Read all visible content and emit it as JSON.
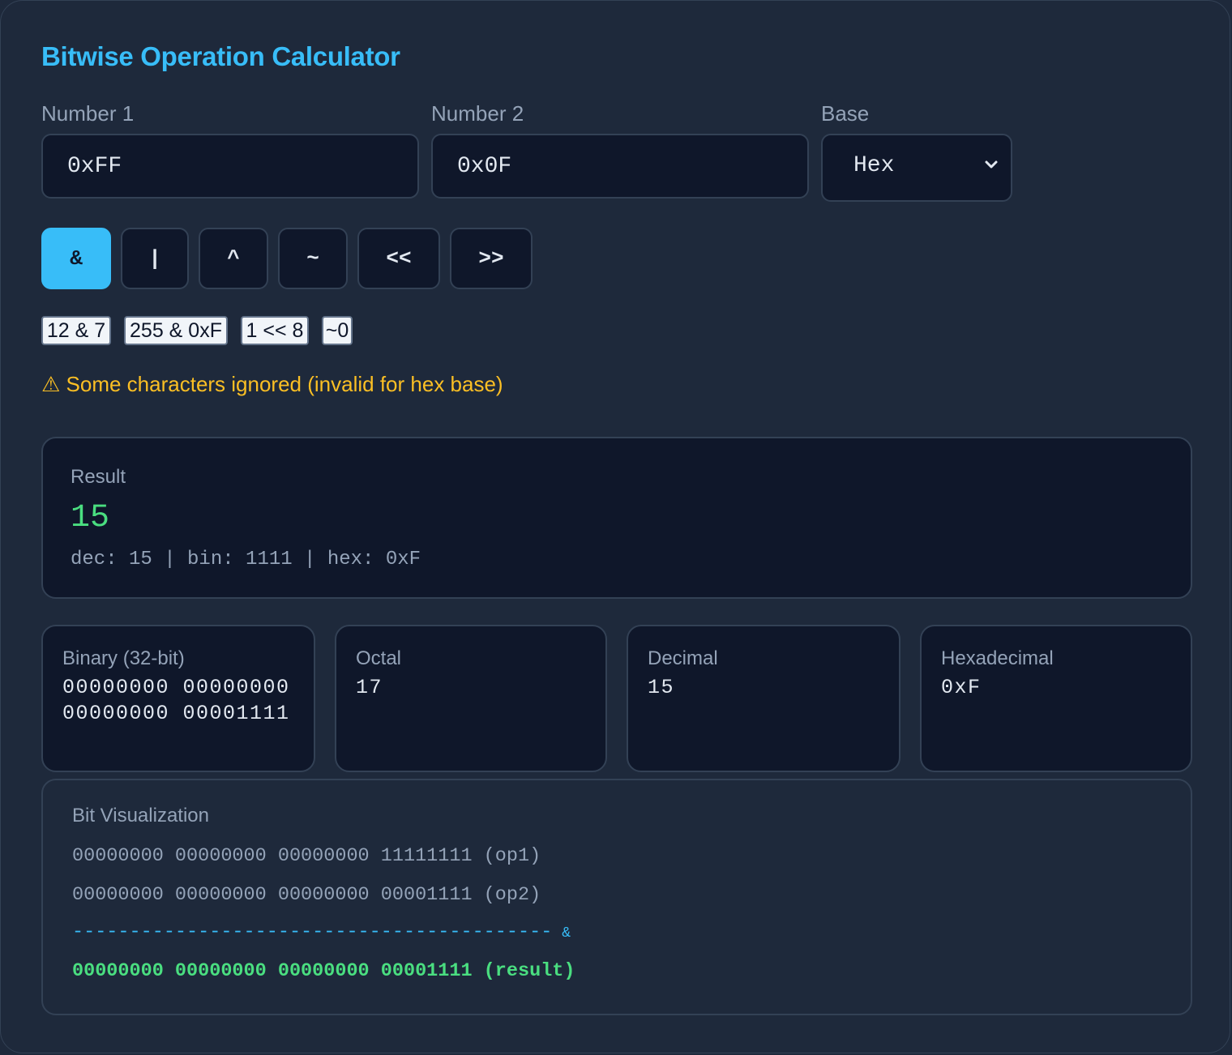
{
  "app": {
    "title": "Bitwise Operation Calculator"
  },
  "inputs": {
    "number1_label": "Number 1",
    "number1_value": "0xFF",
    "number2_label": "Number 2",
    "number2_value": "0x0F",
    "base_label": "Base",
    "base_value": "Hex",
    "base_icon": "chevron-down-icon"
  },
  "operators": [
    "&",
    "|",
    "^",
    "~",
    "<<",
    ">>"
  ],
  "active_operator": "&",
  "examples": [
    "12 & 7",
    "255 & 0xF",
    "1 << 8",
    "~0"
  ],
  "warning": {
    "icon": "warning-icon",
    "text": "⚠ Some characters ignored (invalid for hex base)"
  },
  "result": {
    "label": "Result",
    "value": "15",
    "summary": "dec: 15 | bin: 1111 | hex: 0xF"
  },
  "conversions": [
    {
      "label": "Binary (32-bit)",
      "value": "00000000 00000000 00000000 00001111"
    },
    {
      "label": "Octal",
      "value": "17"
    },
    {
      "label": "Decimal",
      "value": "15"
    },
    {
      "label": "Hexadecimal",
      "value": "0xF"
    }
  ],
  "visualization": {
    "title": "Bit Visualization",
    "op1_line": "00000000 00000000 00000000 11111111 (op1)",
    "op2_line": "00000000 00000000 00000000 00001111 (op2)",
    "separator": "------------------------------------------",
    "separator_symbol": "&",
    "result_line": "00000000 00000000 00000000 00001111 (result)"
  },
  "colors": {
    "accent": "#38bdf8",
    "success": "#4ade80",
    "warning": "#fbbf24",
    "background": "#1e293b",
    "panel": "#0f172a"
  }
}
